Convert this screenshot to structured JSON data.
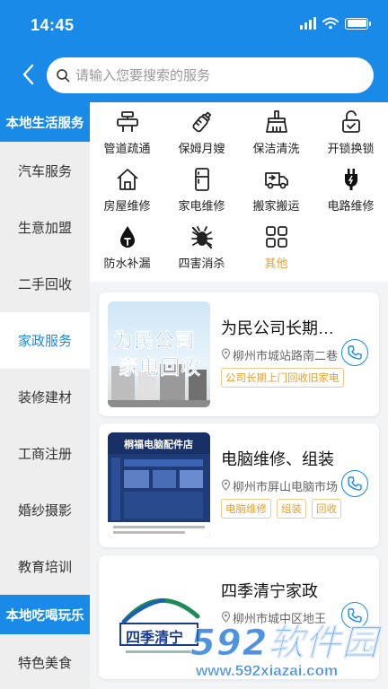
{
  "status": {
    "time": "14:45",
    "battery_level": 1.0
  },
  "search": {
    "placeholder": "请输入您要搜索的服务"
  },
  "sidebar": {
    "section1": "本地生活服务",
    "items": [
      "汽车服务",
      "生意加盟",
      "二手回收",
      "家政服务",
      "装修建材",
      "工商注册",
      "婚纱摄影",
      "教育培训"
    ],
    "active_index": 3,
    "section2": "本地吃喝玩乐",
    "items2": [
      "特色美食"
    ]
  },
  "categories": [
    {
      "label": "管道疏通",
      "icon": "pipe-icon"
    },
    {
      "label": "保姆月嫂",
      "icon": "baby-bottle-icon"
    },
    {
      "label": "保洁清洗",
      "icon": "broom-icon"
    },
    {
      "label": "开锁换锁",
      "icon": "unlock-icon"
    },
    {
      "label": "房屋维修",
      "icon": "house-icon"
    },
    {
      "label": "家电维修",
      "icon": "fridge-icon"
    },
    {
      "label": "搬家搬运",
      "icon": "truck-icon"
    },
    {
      "label": "电路维修",
      "icon": "plug-icon"
    },
    {
      "label": "防水补漏",
      "icon": "water-drop-icon"
    },
    {
      "label": "四害消杀",
      "icon": "pest-control-icon"
    },
    {
      "label": "其他",
      "icon": "grid-icon"
    }
  ],
  "listings": [
    {
      "title": "为民公司长期上门回收旧家电",
      "address": "柳州市城站路南二巷",
      "tags": [
        "公司长期上门回收旧家电"
      ],
      "thumb_text": [
        "为民公司",
        "家电回收"
      ]
    },
    {
      "title": "电脑维修、组装",
      "address": "柳州市屏山电脑市场",
      "tags": [
        "电脑维修",
        "组装",
        "回收"
      ],
      "thumb_text": [
        "桐福电脑配件店"
      ]
    },
    {
      "title": "四季清宁家政",
      "address": "柳州市城中区地王",
      "tags": [],
      "thumb_text": [
        "四季清宁"
      ]
    }
  ],
  "watermark": {
    "brand": "592软件园",
    "url": "www.592xiazai.com"
  },
  "colors": {
    "primary": "#1a8ae8",
    "accent_orange": "#e2a033"
  }
}
